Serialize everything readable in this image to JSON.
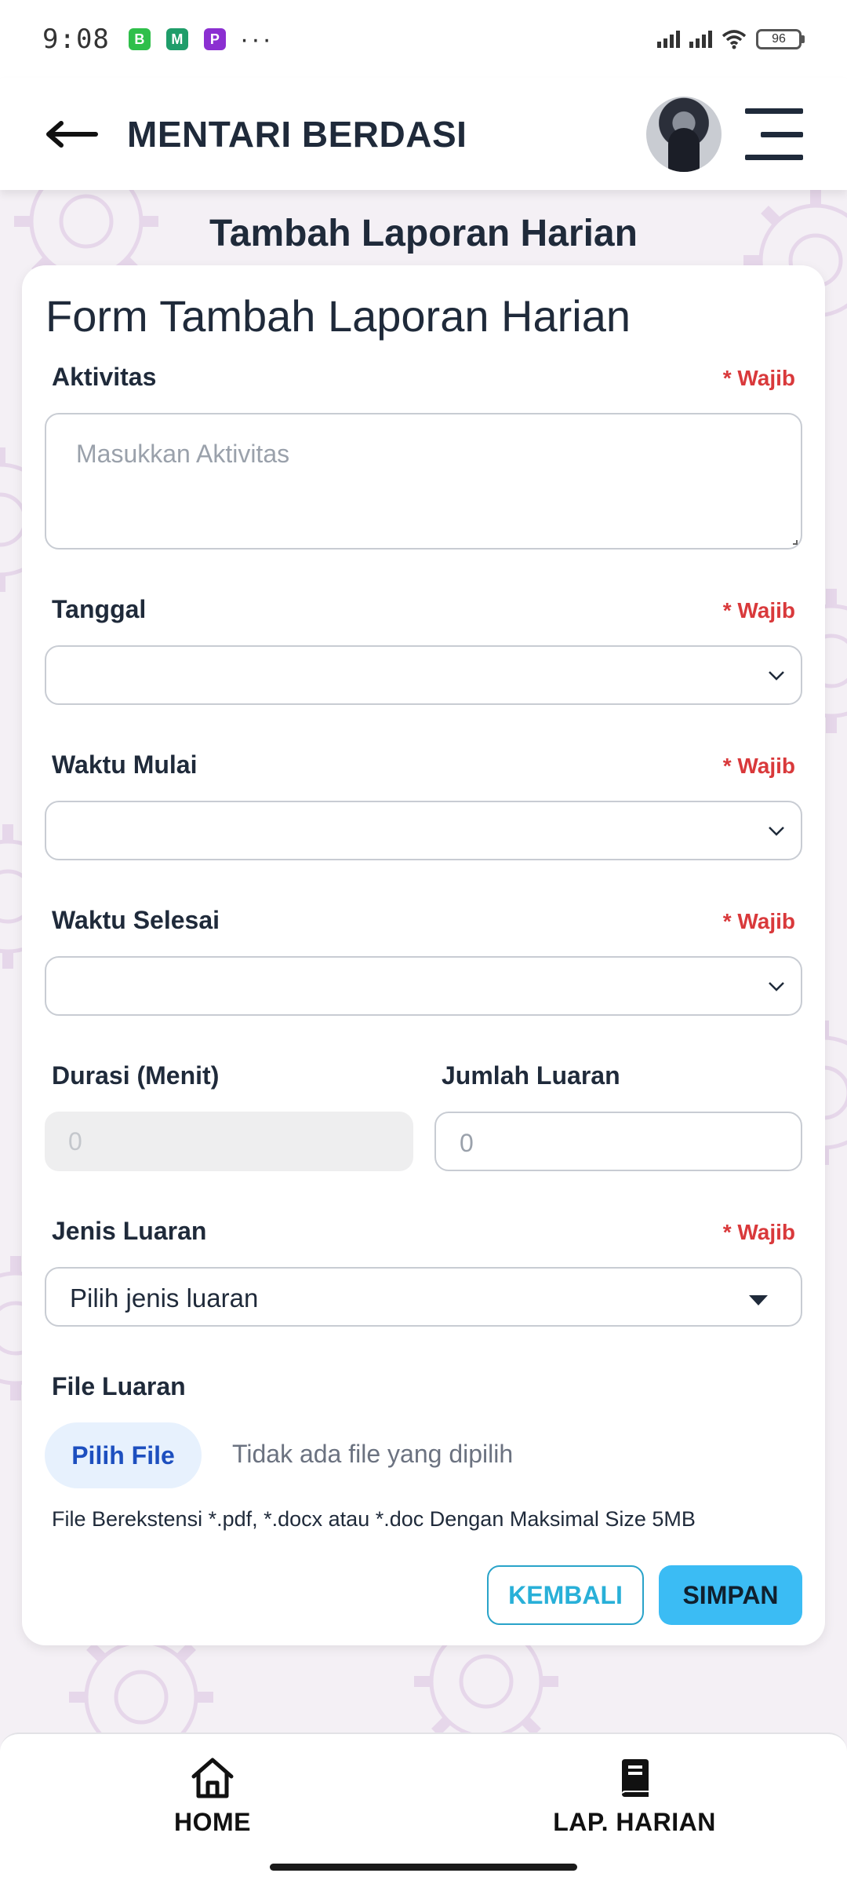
{
  "status_bar": {
    "time": "9:08",
    "apps": [
      "B",
      "M",
      "P"
    ],
    "more": "···",
    "battery": "96"
  },
  "header": {
    "title": "MENTARI BERDASI"
  },
  "page": {
    "heading": "Tambah Laporan Harian"
  },
  "form": {
    "title": "Form Tambah Laporan Harian",
    "required_label": "* Wajib",
    "aktivitas": {
      "label": "Aktivitas",
      "placeholder": "Masukkan Aktivitas"
    },
    "tanggal": {
      "label": "Tanggal",
      "value": ""
    },
    "waktu_mulai": {
      "label": "Waktu Mulai",
      "value": ""
    },
    "waktu_selesai": {
      "label": "Waktu Selesai",
      "value": ""
    },
    "durasi": {
      "label": "Durasi (Menit)",
      "value": "0"
    },
    "jumlah_luaran": {
      "label": "Jumlah Luaran",
      "value": "0"
    },
    "jenis_luaran": {
      "label": "Jenis Luaran",
      "value": "Pilih jenis luaran"
    },
    "file_luaran": {
      "label": "File Luaran",
      "button": "Pilih File",
      "status": "Tidak ada file yang dipilih",
      "hint": "File Berekstensi *.pdf, *.docx atau *.doc Dengan Maksimal Size 5MB"
    },
    "buttons": {
      "back": "KEMBALI",
      "save": "SIMPAN"
    }
  },
  "bottom_nav": {
    "items": [
      {
        "label": "HOME",
        "icon": "home-icon"
      },
      {
        "label": "LAP. HARIAN",
        "icon": "book-icon"
      }
    ]
  },
  "colors": {
    "accent": "#3bbcf4",
    "required": "#d9393b",
    "title": "#1f2a3a",
    "file_button_bg": "#e7f1fd",
    "file_button_text": "#1d4fbf"
  }
}
